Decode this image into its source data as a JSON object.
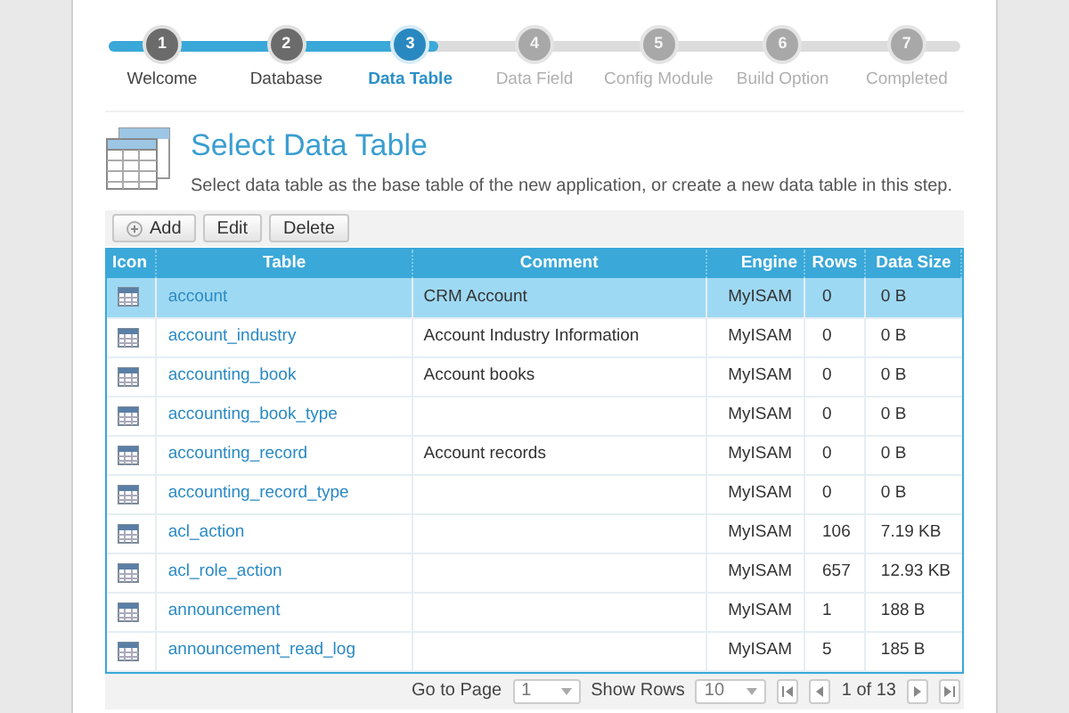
{
  "steps": [
    {
      "number": "1",
      "label": "Welcome",
      "completed": true,
      "selected": false
    },
    {
      "number": "2",
      "label": "Database",
      "completed": true,
      "selected": false
    },
    {
      "number": "3",
      "label": "Data Table",
      "completed": false,
      "selected": true
    },
    {
      "number": "4",
      "label": "Data Field",
      "completed": false,
      "selected": false
    },
    {
      "number": "5",
      "label": "Config Module",
      "completed": false,
      "selected": false
    },
    {
      "number": "6",
      "label": "Build Option",
      "completed": false,
      "selected": false
    },
    {
      "number": "7",
      "label": "Completed",
      "completed": false,
      "selected": false
    }
  ],
  "header": {
    "title": "Select Data Table",
    "description": "Select data table as the base table of the new application, or create a new data table in this step."
  },
  "toolbar": [
    "Add",
    "Edit",
    "Delete"
  ],
  "table": {
    "columns": [
      "Icon",
      "Table",
      "Comment",
      "Engine",
      "Rows",
      "Data Size"
    ],
    "rows": [
      {
        "table": "account",
        "comment": "CRM Account",
        "engine": "MyISAM",
        "rows": "0",
        "size": "0 B",
        "selected": true
      },
      {
        "table": "account_industry",
        "comment": "Account Industry Information",
        "engine": "MyISAM",
        "rows": "0",
        "size": "0 B",
        "selected": false
      },
      {
        "table": "accounting_book",
        "comment": "Account books",
        "engine": "MyISAM",
        "rows": "0",
        "size": "0 B",
        "selected": false
      },
      {
        "table": "accounting_book_type",
        "engine": "MyISAM",
        "rows": "0",
        "size": "0 B",
        "selected": false
      },
      {
        "table": "accounting_record",
        "comment": "Account records",
        "engine": "MyISAM",
        "rows": "0",
        "size": "0 B",
        "selected": false
      },
      {
        "table": "accounting_record_type",
        "engine": "MyISAM",
        "rows": "0",
        "size": "0 B",
        "selected": false
      },
      {
        "table": "acl_action",
        "engine": "MyISAM",
        "rows": "106",
        "size": "7.19 KB",
        "selected": false
      },
      {
        "table": "acl_role_action",
        "engine": "MyISAM",
        "rows": "657",
        "size": "12.93 KB",
        "selected": false
      },
      {
        "table": "announcement",
        "engine": "MyISAM",
        "rows": "1",
        "size": "188 B",
        "selected": false
      },
      {
        "table": "announcement_read_log",
        "engine": "MyISAM",
        "rows": "5",
        "size": "185 B",
        "selected": false
      }
    ]
  },
  "pager": {
    "go_to_label": "Go to Page",
    "page": "1",
    "show_rows_label": "Show Rows",
    "rows": "10",
    "page_info": "1 of 13"
  }
}
